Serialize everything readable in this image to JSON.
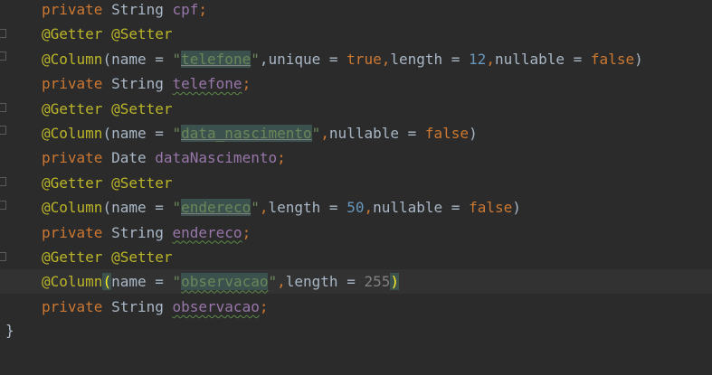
{
  "editor": {
    "lines": [
      {
        "parts": [
          {
            "t": "private",
            "c": "kw"
          },
          {
            "t": " String ",
            "c": "plain"
          },
          {
            "t": "cpf",
            "c": "field"
          },
          {
            "t": ";",
            "c": "kw"
          }
        ]
      },
      {
        "parts": [
          {
            "t": "@Getter @Setter",
            "c": "ann"
          }
        ]
      },
      {
        "parts": [
          {
            "t": "@Column",
            "c": "ann"
          },
          {
            "t": "(name = ",
            "c": "plain"
          },
          {
            "t": "\"",
            "c": "str"
          },
          {
            "t": "telefone",
            "c": "str hl"
          },
          {
            "t": "\"",
            "c": "str"
          },
          {
            "t": ",unique = ",
            "c": "plain"
          },
          {
            "t": "true",
            "c": "kw"
          },
          {
            "t": ",",
            "c": "kw"
          },
          {
            "t": "length = ",
            "c": "plain"
          },
          {
            "t": "12",
            "c": "num"
          },
          {
            "t": ",",
            "c": "kw"
          },
          {
            "t": "nullable = ",
            "c": "plain"
          },
          {
            "t": "false",
            "c": "kw"
          },
          {
            "t": ")",
            "c": "plain"
          }
        ]
      },
      {
        "parts": [
          {
            "t": "private",
            "c": "kw"
          },
          {
            "t": " String ",
            "c": "plain"
          },
          {
            "t": "telefone",
            "c": "field typo"
          },
          {
            "t": ";",
            "c": "kw"
          }
        ]
      },
      {
        "parts": [
          {
            "t": "@Getter @Setter",
            "c": "ann"
          }
        ]
      },
      {
        "parts": [
          {
            "t": "@Column",
            "c": "ann"
          },
          {
            "t": "(name = ",
            "c": "plain"
          },
          {
            "t": "\"",
            "c": "str"
          },
          {
            "t": "data_nascimento",
            "c": "str hl"
          },
          {
            "t": "\"",
            "c": "str"
          },
          {
            "t": ",",
            "c": "kw"
          },
          {
            "t": "nullable = ",
            "c": "plain"
          },
          {
            "t": "false",
            "c": "kw"
          },
          {
            "t": ")",
            "c": "plain"
          }
        ]
      },
      {
        "parts": [
          {
            "t": "private",
            "c": "kw"
          },
          {
            "t": " Date ",
            "c": "plain"
          },
          {
            "t": "dataNascimento",
            "c": "field"
          },
          {
            "t": ";",
            "c": "kw"
          }
        ]
      },
      {
        "parts": [
          {
            "t": "@Getter @Setter",
            "c": "ann"
          }
        ]
      },
      {
        "parts": [
          {
            "t": "@Column",
            "c": "ann"
          },
          {
            "t": "(name = ",
            "c": "plain"
          },
          {
            "t": "\"",
            "c": "str"
          },
          {
            "t": "endereco",
            "c": "str hl"
          },
          {
            "t": "\"",
            "c": "str"
          },
          {
            "t": ",",
            "c": "kw"
          },
          {
            "t": "length = ",
            "c": "plain"
          },
          {
            "t": "50",
            "c": "num"
          },
          {
            "t": ",",
            "c": "kw"
          },
          {
            "t": "nullable = ",
            "c": "plain"
          },
          {
            "t": "false",
            "c": "kw"
          },
          {
            "t": ")",
            "c": "plain"
          }
        ]
      },
      {
        "parts": [
          {
            "t": "private",
            "c": "kw"
          },
          {
            "t": " String ",
            "c": "plain"
          },
          {
            "t": "endereco",
            "c": "field typo"
          },
          {
            "t": ";",
            "c": "kw"
          }
        ]
      },
      {
        "parts": [
          {
            "t": "@Getter @Setter",
            "c": "ann"
          }
        ]
      },
      {
        "parts": [
          {
            "t": "@Column",
            "c": "ann"
          },
          {
            "t": "(",
            "c": "brace"
          },
          {
            "t": "name = ",
            "c": "plain"
          },
          {
            "t": "\"",
            "c": "str"
          },
          {
            "t": "observacao",
            "c": "str hl typo"
          },
          {
            "t": "\"",
            "c": "str"
          },
          {
            "t": ",",
            "c": "kw"
          },
          {
            "t": "length = ",
            "c": "plain"
          },
          {
            "t": "255",
            "c": "num-dim"
          },
          {
            "t": ")",
            "c": "brace"
          }
        ],
        "current": true
      },
      {
        "parts": [
          {
            "t": "private",
            "c": "kw"
          },
          {
            "t": " String ",
            "c": "plain"
          },
          {
            "t": "observacao",
            "c": "field typo"
          },
          {
            "t": ";",
            "c": "kw"
          }
        ]
      }
    ],
    "closing": "}"
  }
}
